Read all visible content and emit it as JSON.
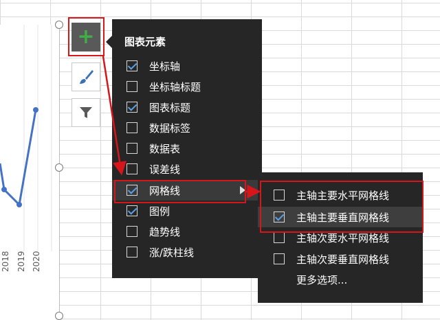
{
  "chart": {
    "years": [
      "2018",
      "2019",
      "2020"
    ]
  },
  "side_buttons": [
    {
      "icon": "plus-icon"
    },
    {
      "icon": "paintbrush-icon"
    },
    {
      "icon": "filter-icon"
    }
  ],
  "panel": {
    "title": "图表元素",
    "items": [
      {
        "label": "坐标轴",
        "checked": true
      },
      {
        "label": "坐标轴标题",
        "checked": false
      },
      {
        "label": "图表标题",
        "checked": true
      },
      {
        "label": "数据标签",
        "checked": false
      },
      {
        "label": "数据表",
        "checked": false
      },
      {
        "label": "误差线",
        "checked": false
      },
      {
        "label": "网格线",
        "checked": true
      },
      {
        "label": "图例",
        "checked": true
      },
      {
        "label": "趋势线",
        "checked": false
      },
      {
        "label": "涨/跌柱线",
        "checked": false
      }
    ]
  },
  "submenu": {
    "items": [
      {
        "label": "主轴主要水平网格线",
        "checked": false
      },
      {
        "label": "主轴主要垂直网格线",
        "checked": true
      },
      {
        "label": "主轴次要水平网格线",
        "checked": false
      },
      {
        "label": "主轴次要垂直网格线",
        "checked": false
      }
    ],
    "more_label": "更多选项..."
  },
  "colors": {
    "panel_bg": "#262626",
    "accent_check": "#5aa0e8",
    "annotation_red": "#d6161b",
    "plus_green": "#3fae49",
    "line_blue": "#4472c4"
  }
}
